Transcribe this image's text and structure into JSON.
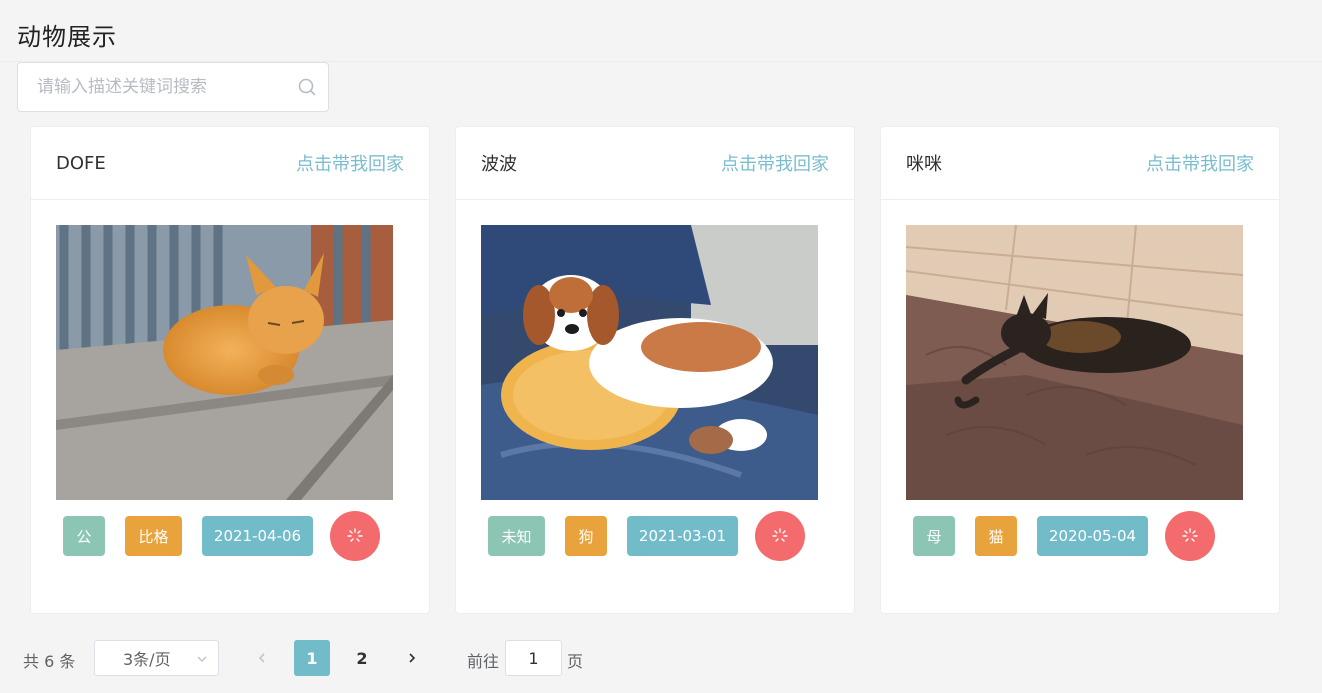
{
  "page": {
    "title": "动物展示"
  },
  "search": {
    "placeholder": "请输入描述关键词搜索",
    "value": ""
  },
  "cards": [
    {
      "name": "DOFE",
      "link": "点击带我回家",
      "tags": {
        "sex": "公",
        "breed": "比格",
        "date": "2021-04-06"
      }
    },
    {
      "name": "波波",
      "link": "点击带我回家",
      "tags": {
        "sex": "未知",
        "breed": "狗",
        "date": "2021-03-01"
      }
    },
    {
      "name": "咪咪",
      "link": "点击带我回家",
      "tags": {
        "sex": "母",
        "breed": "猫",
        "date": "2020-05-04"
      }
    }
  ],
  "pagination": {
    "total": "共 6 条",
    "page_size": "3条/页",
    "pages": [
      "1",
      "2"
    ],
    "current_page": "1",
    "jump_label": "前往",
    "jump_value": "1",
    "page_label": "页"
  },
  "colors": {
    "accent": "#72bcc9",
    "link": "#79bdcf",
    "tag_green": "#8cc5b3",
    "tag_orange": "#e8a33c",
    "like": "#f46b6e"
  },
  "icons": {
    "search": "search-icon",
    "like": "loading-spinner-icon",
    "prev": "chevron-left-icon",
    "next": "chevron-right-icon",
    "select": "chevron-down-icon"
  }
}
